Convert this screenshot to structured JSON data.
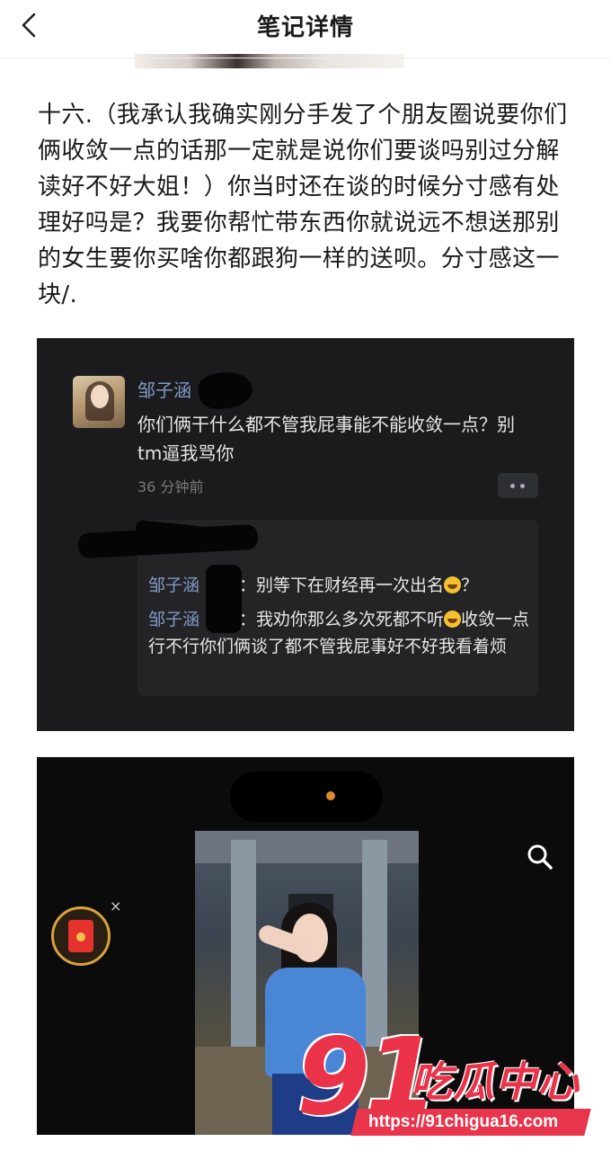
{
  "header": {
    "back_icon": "chevron-left-icon",
    "title": "笔记详情"
  },
  "post": {
    "body": "十六.（我承认我确实刚分手发了个朋友圈说要你们俩收敛一点的话那一定就是说你们要谈吗别过分解读好不好大姐！）你当时还在谈的时候分寸感有处理好吗是？我要你帮忙带东西你就说远不想送那别的女生要你买啥你都跟狗一样的送呗。分寸感这一块/."
  },
  "screenshot_comment": {
    "commenter_name": "邹子涵",
    "comment_text": "你们俩干什么都不管我屁事能不能收敛一点？别tm逼我骂你",
    "time": "36 分钟前",
    "more_icon": "more-dots-icon",
    "replies": [
      {
        "name": "邹子涵",
        "sep": "：",
        "text": "别等下在财经再一次出名",
        "tail": "？",
        "emoji": "laughing-crying-emoji"
      },
      {
        "name": "邹子涵",
        "sep": "：",
        "text": "我劝你那么多次死都不听",
        "tail": "收敛一点行不行你们俩谈了都不管我屁事好不好我看着烦",
        "emoji": "laughing-crying-emoji"
      }
    ]
  },
  "screenshot_video": {
    "search_icon": "search-icon",
    "redpacket_icon": "red-envelope-icon",
    "close_label": "×"
  },
  "watermark": {
    "number": "91",
    "text": "吃瓜中心",
    "url": "https://91chigua16.com"
  },
  "colors": {
    "accent_red": "#ea3249",
    "dark_panel": "#1b1b1d",
    "name_blue": "#7f98c4"
  }
}
